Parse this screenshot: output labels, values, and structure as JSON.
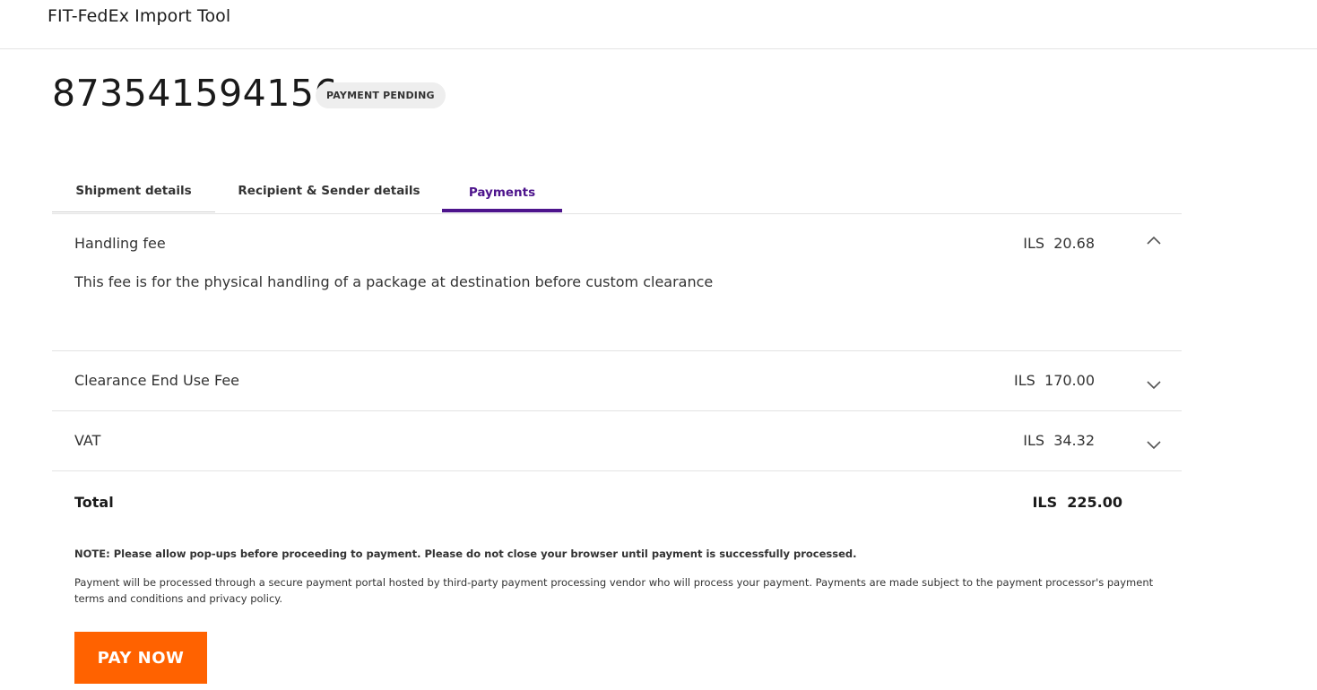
{
  "app": {
    "title": "FIT-FedEx Import Tool"
  },
  "shipment": {
    "tracking_number": "873541594156",
    "status_badge": "PAYMENT PENDING"
  },
  "tabs": [
    {
      "label": "Shipment details",
      "active": false
    },
    {
      "label": "Recipient & Sender details",
      "active": false
    },
    {
      "label": "Payments",
      "active": true
    }
  ],
  "fees": [
    {
      "name": "Handling fee",
      "amount": "ILS  20.68",
      "expanded": true,
      "chevron_icon": "chevron-up-icon",
      "description": "This fee is for the physical handling of a package at destination before custom clearance"
    },
    {
      "name": "Clearance End Use Fee",
      "amount": "ILS  170.00",
      "expanded": false,
      "chevron_icon": "chevron-down-icon"
    },
    {
      "name": "VAT",
      "amount": "ILS  34.32",
      "expanded": false,
      "chevron_icon": "chevron-down-icon"
    }
  ],
  "total": {
    "label": "Total",
    "amount": "ILS  225.00"
  },
  "note": "NOTE: Please allow pop-ups before proceeding to payment. Please do not close your browser until payment is successfully processed.",
  "disclaimer": "Payment will be processed through a secure payment portal hosted by third-party payment processing vendor who will process your payment. Payments are made subject to the payment processor's payment terms and conditions and privacy policy.",
  "pay_button": {
    "label": "PAY NOW"
  },
  "colors": {
    "accent_purple": "#4d148c",
    "pay_button_orange": "#ff6200",
    "badge_background": "#eeeeee",
    "divider": "#e3e3e3"
  }
}
